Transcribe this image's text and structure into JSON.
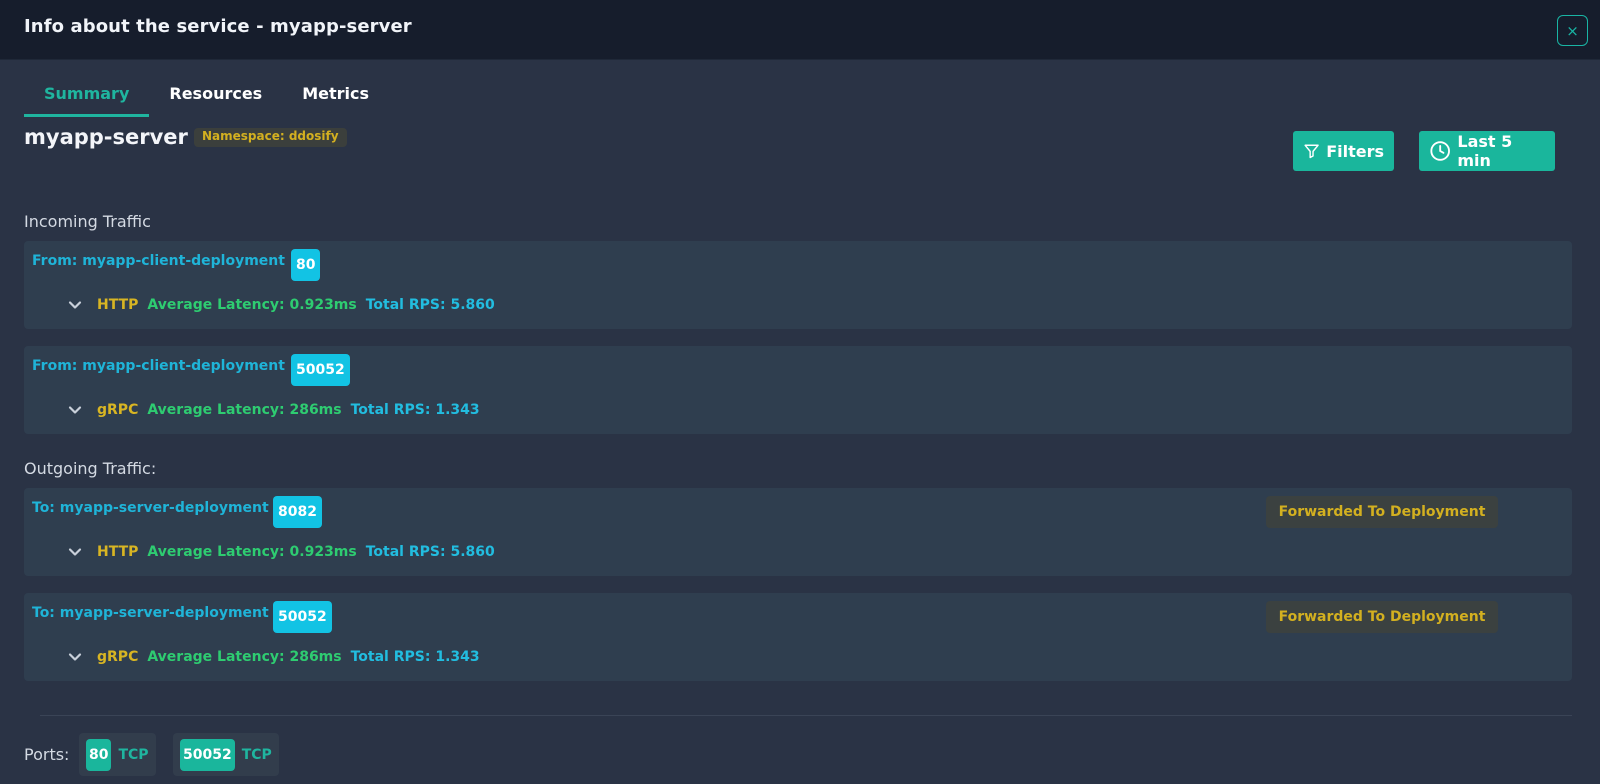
{
  "window": {
    "title": "Info about the service - myapp-server",
    "close_symbol": "×"
  },
  "tabs": [
    {
      "label": "Summary",
      "active": true
    },
    {
      "label": "Resources",
      "active": false
    },
    {
      "label": "Metrics",
      "active": false
    }
  ],
  "service": {
    "name": "myapp-server",
    "namespace_badge": "Namespace: ddosify"
  },
  "toolbar": {
    "filters_label": "Filters",
    "time_range_label": "Last 5 min"
  },
  "incoming": {
    "title": "Incoming Traffic",
    "rows": [
      {
        "from": "From: myapp-client-deployment",
        "port": "80",
        "protocol": "HTTP",
        "latency": "Average Latency: 0.923ms",
        "rps": "Total RPS: 5.860"
      },
      {
        "from": "From: myapp-client-deployment",
        "port": "50052",
        "protocol": "gRPC",
        "latency": "Average Latency: 286ms",
        "rps": "Total RPS: 1.343"
      }
    ]
  },
  "outgoing": {
    "title": "Outgoing Traffic:",
    "rows": [
      {
        "to": "To: myapp-server-deployment",
        "port": "8082",
        "badge": "Forwarded To Deployment",
        "protocol": "HTTP",
        "latency": "Average Latency: 0.923ms",
        "rps": "Total RPS: 5.860"
      },
      {
        "to": "To: myapp-server-deployment",
        "port": "50052",
        "badge": "Forwarded To Deployment",
        "protocol": "gRPC",
        "latency": "Average Latency: 286ms",
        "rps": "Total RPS: 1.343"
      }
    ]
  },
  "ports": {
    "label": "Ports:",
    "items": [
      {
        "number": "80",
        "protocol": "TCP"
      },
      {
        "number": "50052",
        "protocol": "TCP"
      }
    ]
  },
  "colors": {
    "accent": "#1ab69c",
    "link": "#1fb4d8",
    "warning_text": "#d3b020",
    "latency": "#2ecc71",
    "background": "#2a3345"
  }
}
